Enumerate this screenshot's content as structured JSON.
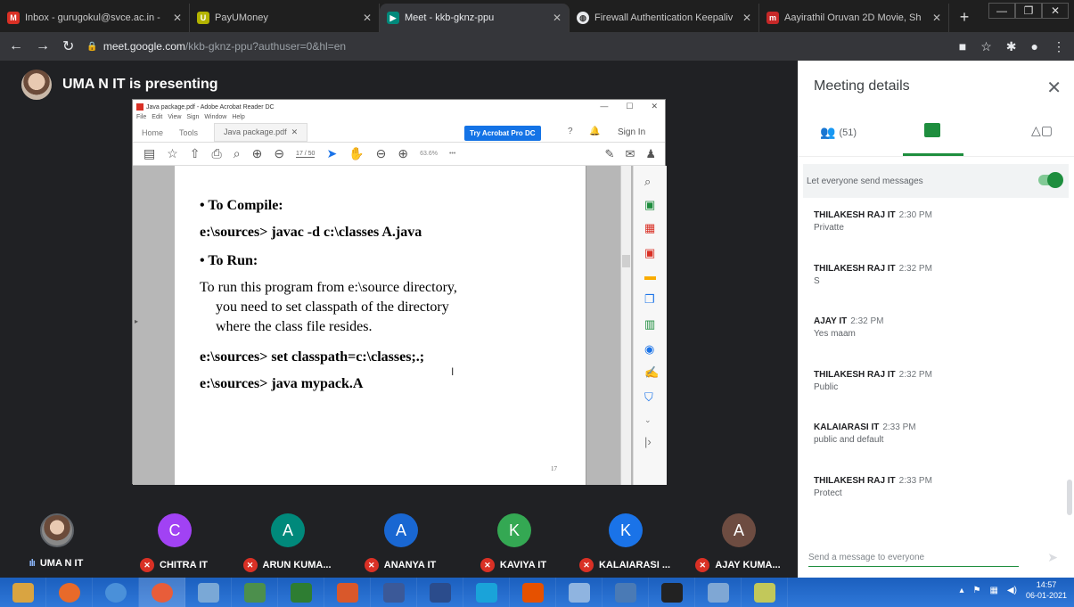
{
  "browser": {
    "tabs": [
      {
        "title": "Inbox - gurugokul@svce.ac.in -",
        "icon": "gmail-icon",
        "color": "#d93025",
        "glyph": "M",
        "active": false
      },
      {
        "title": "PayUMoney",
        "icon": "payumoney-icon",
        "color": "#b3b300",
        "glyph": "U",
        "active": false
      },
      {
        "title": "Meet - kkb-gknz-ppu",
        "icon": "meet-icon",
        "color": "#00897b",
        "glyph": "▶",
        "active": true
      },
      {
        "title": "Firewall Authentication Keepaliv",
        "icon": "globe-icon",
        "color": "#e8eaed",
        "glyph": "◍",
        "active": false
      },
      {
        "title": "Aayirathil Oruvan 2D Movie, Sh",
        "icon": "movie-icon",
        "color": "#c62828",
        "glyph": "m",
        "active": false
      }
    ],
    "new_tab": "+",
    "url_host": "meet.google.com",
    "url_path": "/kkb-gknz-ppu?authuser=0&hl=en"
  },
  "meet": {
    "presenting_label": "UMA N IT is presenting",
    "panel_title": "Meeting details",
    "participant_count": "(51)",
    "toggle_label": "Let everyone send messages",
    "send_placeholder": "Send a message to everyone",
    "messages": [
      {
        "name": "THILAKESH RAJ IT",
        "time": "2:30 PM",
        "text": "Privatte"
      },
      {
        "name": "THILAKESH RAJ IT",
        "time": "2:32 PM",
        "text": "S"
      },
      {
        "name": "AJAY IT",
        "time": "2:32 PM",
        "text": "Yes maam"
      },
      {
        "name": "THILAKESH RAJ IT",
        "time": "2:32 PM",
        "text": "Public"
      },
      {
        "name": "KALAIARASI IT",
        "time": "2:33 PM",
        "text": "public and default"
      },
      {
        "name": "THILAKESH RAJ IT",
        "time": "2:33 PM",
        "text": "Protect"
      }
    ],
    "participants": [
      {
        "name": "UMA N IT",
        "initial": "",
        "color": "#6b4b3a",
        "muted": false
      },
      {
        "name": "CHITRA IT",
        "initial": "C",
        "color": "#a142f4",
        "muted": true
      },
      {
        "name": "ARUN KUMA...",
        "initial": "A",
        "color": "#00897b",
        "muted": true
      },
      {
        "name": "ANANYA IT",
        "initial": "A",
        "color": "#1967d2",
        "muted": true
      },
      {
        "name": "KAVIYA IT",
        "initial": "K",
        "color": "#34a853",
        "muted": true
      },
      {
        "name": "KALAIARASI ...",
        "initial": "K",
        "color": "#1a73e8",
        "muted": true
      },
      {
        "name": "AJAY KUMA...",
        "initial": "A",
        "color": "#6d4c41",
        "muted": true
      }
    ]
  },
  "acrobat": {
    "window_title": "Java package.pdf - Adobe Acrobat Reader DC",
    "menu": [
      "File",
      "Edit",
      "View",
      "Sign",
      "Window",
      "Help"
    ],
    "tab_home": "Home",
    "tab_tools": "Tools",
    "tab_doc": "Java package.pdf",
    "try_button": "Try Acrobat Pro DC",
    "sign_in": "Sign In",
    "page_indicator": "17 / 50",
    "zoom": "63.6%",
    "page_number": "17",
    "content": [
      {
        "text": "• To Compile:",
        "bold": true
      },
      {
        "text": "e:\\sources> javac -d c:\\classes A.java",
        "bold": true
      },
      {
        "text": "• To Run:",
        "bold": true
      },
      {
        "text": "To run this program from e:\\source directory,",
        "bold": false
      },
      {
        "text": "you need to set classpath of the directory",
        "bold": false
      },
      {
        "text": "where the class file resides.",
        "bold": false
      },
      {
        "text": "e:\\sources> set classpath=c:\\classes;.;",
        "bold": true
      },
      {
        "text": "e:\\sources> java mypack.A",
        "bold": true
      }
    ]
  },
  "taskbar": {
    "time": "14:57",
    "date": "06-01-2021",
    "apps": [
      "#d9a441",
      "#e86a2a",
      "#4a90d9",
      "#e85d3a",
      "#7aa8d6",
      "#4c8f4c",
      "#2e7d32",
      "#d9582b",
      "#3b5998",
      "#2b4c8c",
      "#1aa3d9",
      "#e65100",
      "#8fb4e0",
      "#4a7ab5",
      "#222",
      "#7fa7d4",
      "#c2c85a"
    ]
  }
}
